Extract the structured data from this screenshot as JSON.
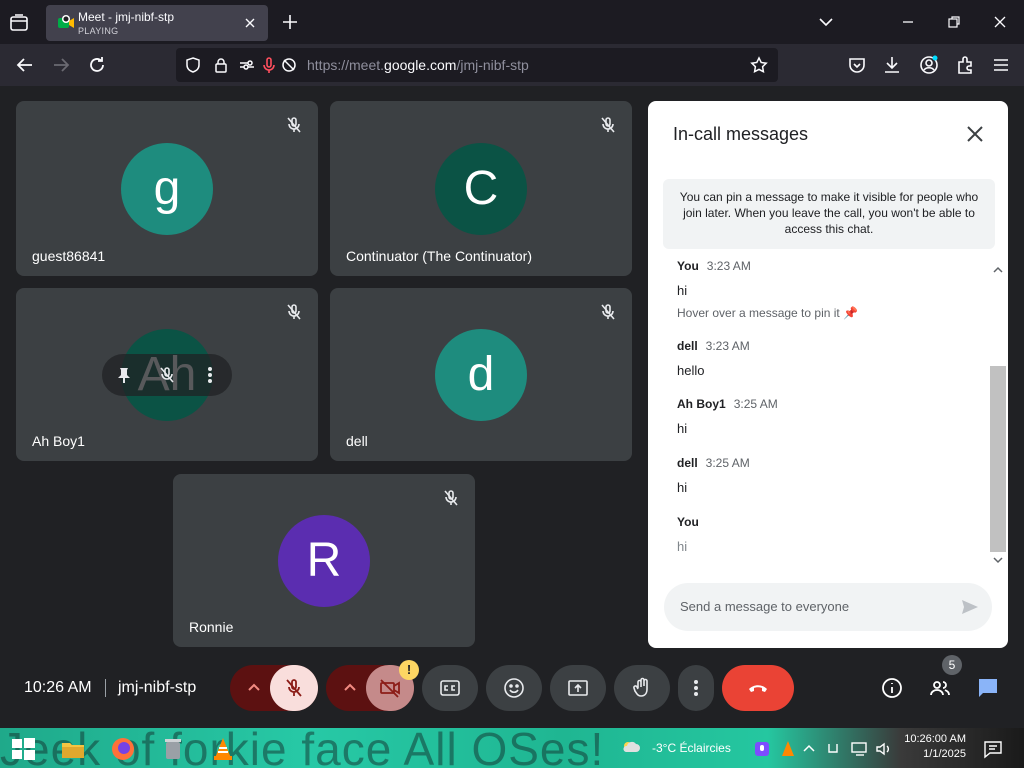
{
  "browser": {
    "tab": {
      "title": "Meet - jmj-nibf-stp",
      "subtitle": "PLAYING"
    },
    "url": {
      "prefix": "https://meet.",
      "host": "google.com",
      "path": "/jmj-nibf-stp"
    }
  },
  "tiles": [
    {
      "initial": "g",
      "name": "guest86841",
      "color": "#1e8c7e"
    },
    {
      "initial": "C",
      "name": "Continuator (The Continuator)",
      "color": "#0b5345"
    },
    {
      "initial": "Ah",
      "name": "Ah Boy1",
      "color": "#0b5345"
    },
    {
      "initial": "d",
      "name": "dell",
      "color": "#1e8c7e"
    },
    {
      "initial": "R",
      "name": "Ronnie",
      "color": "#5b2db0"
    }
  ],
  "chat": {
    "title": "In-call messages",
    "notice": "You can pin a message to make it visible for people who join later. When you leave the call, you won't be able to access this chat.",
    "messages": [
      {
        "sender": "You",
        "time": "3:23 AM",
        "text": "hi",
        "hint": "Hover over a message to pin it"
      },
      {
        "sender": "dell",
        "time": "3:23 AM",
        "text": "hello"
      },
      {
        "sender": "Ah Boy1",
        "time": "3:25 AM",
        "text": "hi"
      },
      {
        "sender": "dell",
        "time": "3:25 AM",
        "text": "hi"
      },
      {
        "sender": "You",
        "time": "",
        "text": "hi"
      }
    ],
    "composer_placeholder": "Send a message to everyone"
  },
  "bottombar": {
    "time": "10:26 AM",
    "meeting_code": "jmj-nibf-stp",
    "warning": "!",
    "participants_count": "5"
  },
  "taskbar": {
    "wallpaper_text": "Jeek of forkie face  All OSes!",
    "weather": "-3°C  Éclaircies",
    "time": "10:26:00 AM",
    "date": "1/1/2025"
  }
}
